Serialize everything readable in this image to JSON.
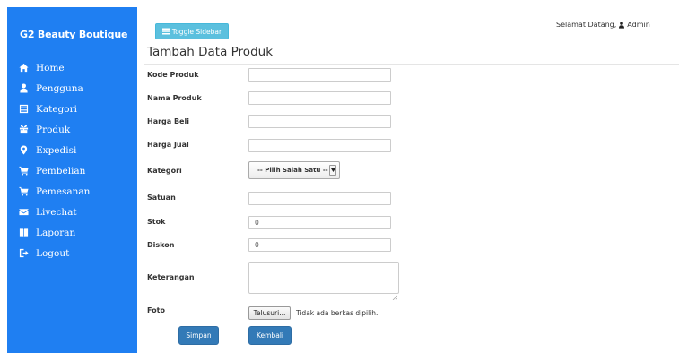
{
  "sidebar": {
    "brand": "G2 Beauty Boutique",
    "items": [
      {
        "label": "Home",
        "icon": "home-icon"
      },
      {
        "label": "Pengguna",
        "icon": "user-icon"
      },
      {
        "label": "Kategori",
        "icon": "list-alt-icon"
      },
      {
        "label": "Produk",
        "icon": "gift-icon"
      },
      {
        "label": "Expedisi",
        "icon": "map-marker-icon"
      },
      {
        "label": "Pembelian",
        "icon": "shopping-cart-icon"
      },
      {
        "label": "Pemesanan",
        "icon": "shopping-cart-icon"
      },
      {
        "label": "Livechat",
        "icon": "envelope-icon"
      },
      {
        "label": "Laporan",
        "icon": "book-icon"
      },
      {
        "label": "Logout",
        "icon": "log-out-icon"
      }
    ]
  },
  "header": {
    "toggle_label": "Toggle Sidebar",
    "welcome_text": "Selamat Datang,",
    "user_name": "Admin"
  },
  "page": {
    "title": "Tambah Data Produk"
  },
  "form": {
    "kode_label": "Kode Produk",
    "kode_value": "",
    "nama_label": "Nama Produk",
    "nama_value": "",
    "harga_beli_label": "Harga Beli",
    "harga_beli_value": "",
    "harga_jual_label": "Harga Jual",
    "harga_jual_value": "",
    "kategori_label": "Kategori",
    "kategori_selected": "-- Pilih Salah Satu --",
    "satuan_label": "Satuan",
    "satuan_value": "",
    "stok_label": "Stok",
    "stok_value": "0",
    "diskon_label": "Diskon",
    "diskon_value": "0",
    "keterangan_label": "Keterangan",
    "keterangan_value": "",
    "foto_label": "Foto",
    "file_button_label": "Telusuri...",
    "file_status": "Tidak ada berkas dipilih.",
    "save_label": "Simpan",
    "back_label": "Kembali"
  },
  "colors": {
    "sidebar_bg": "#1f7ff2",
    "toggle_bg": "#5bc0de",
    "primary": "#337ab7"
  }
}
